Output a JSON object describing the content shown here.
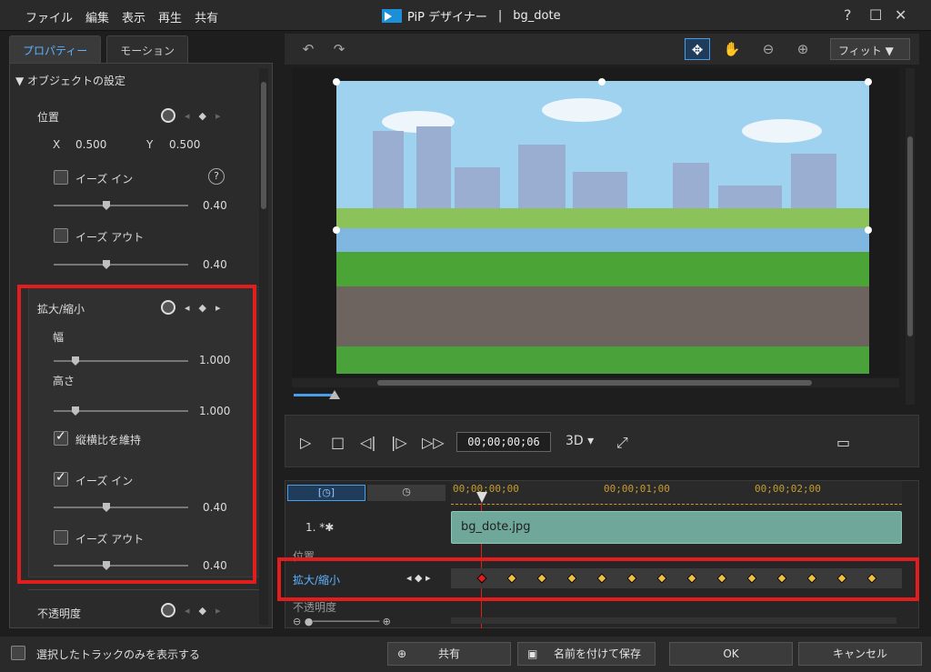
{
  "menu": [
    "ファイル",
    "編集",
    "表示",
    "再生",
    "共有"
  ],
  "window": {
    "app_name": "PiP デザイナー",
    "separator": "|",
    "file": "bg_dote",
    "help": "?",
    "maximize": "☐",
    "close": "✕"
  },
  "tabs": [
    {
      "label": "プロパティー",
      "active": true
    },
    {
      "label": "モーション",
      "active": false
    }
  ],
  "properties": {
    "section_title": "▼ オブジェクトの設定",
    "position": {
      "label": "位置",
      "x_label": "X",
      "x_value": "0.500",
      "y_label": "Y",
      "y_value": "0.500",
      "ease_in_label": "イーズ イン",
      "ease_in_value": "0.40",
      "help": "?",
      "ease_out_label": "イーズ アウト",
      "ease_out_value": "0.40"
    },
    "scale": {
      "label": "拡大/縮小",
      "width_label": "幅",
      "width_value": "1.000",
      "height_label": "高さ",
      "height_value": "1.000",
      "keep_ratio_label": "縦横比を維持",
      "keep_ratio_checked": true,
      "ease_in_label": "イーズ イン",
      "ease_in_checked": true,
      "ease_in_value": "0.40",
      "ease_out_label": "イーズ アウト",
      "ease_out_checked": false,
      "ease_out_value": "0.40"
    },
    "opacity": {
      "label": "不透明度"
    }
  },
  "preview_toolbar": {
    "fit_label": "フィット ▼"
  },
  "playback": {
    "timecode": "00;00;00;06",
    "mode_3d": "3D ▾"
  },
  "timeline": {
    "ruler": [
      "00;00;00;00",
      "00;00;01;00",
      "00;00;02;00"
    ],
    "track1_label": "1. *✱",
    "clip_name": "bg_dote.jpg",
    "rows": [
      {
        "label": "位置"
      },
      {
        "label": "拡大/縮小"
      },
      {
        "label": "不透明度"
      }
    ]
  },
  "bottom": {
    "show_selected": "選択したトラックのみを表示する",
    "share": "共有",
    "save_as": "名前を付けて保存",
    "ok": "OK",
    "cancel": "キャンセル"
  },
  "colors": {
    "accent": "#4a9de8",
    "highlight_red": "#e21d1d",
    "keyframe": "#f0c040",
    "clip": "#6fa89a"
  }
}
